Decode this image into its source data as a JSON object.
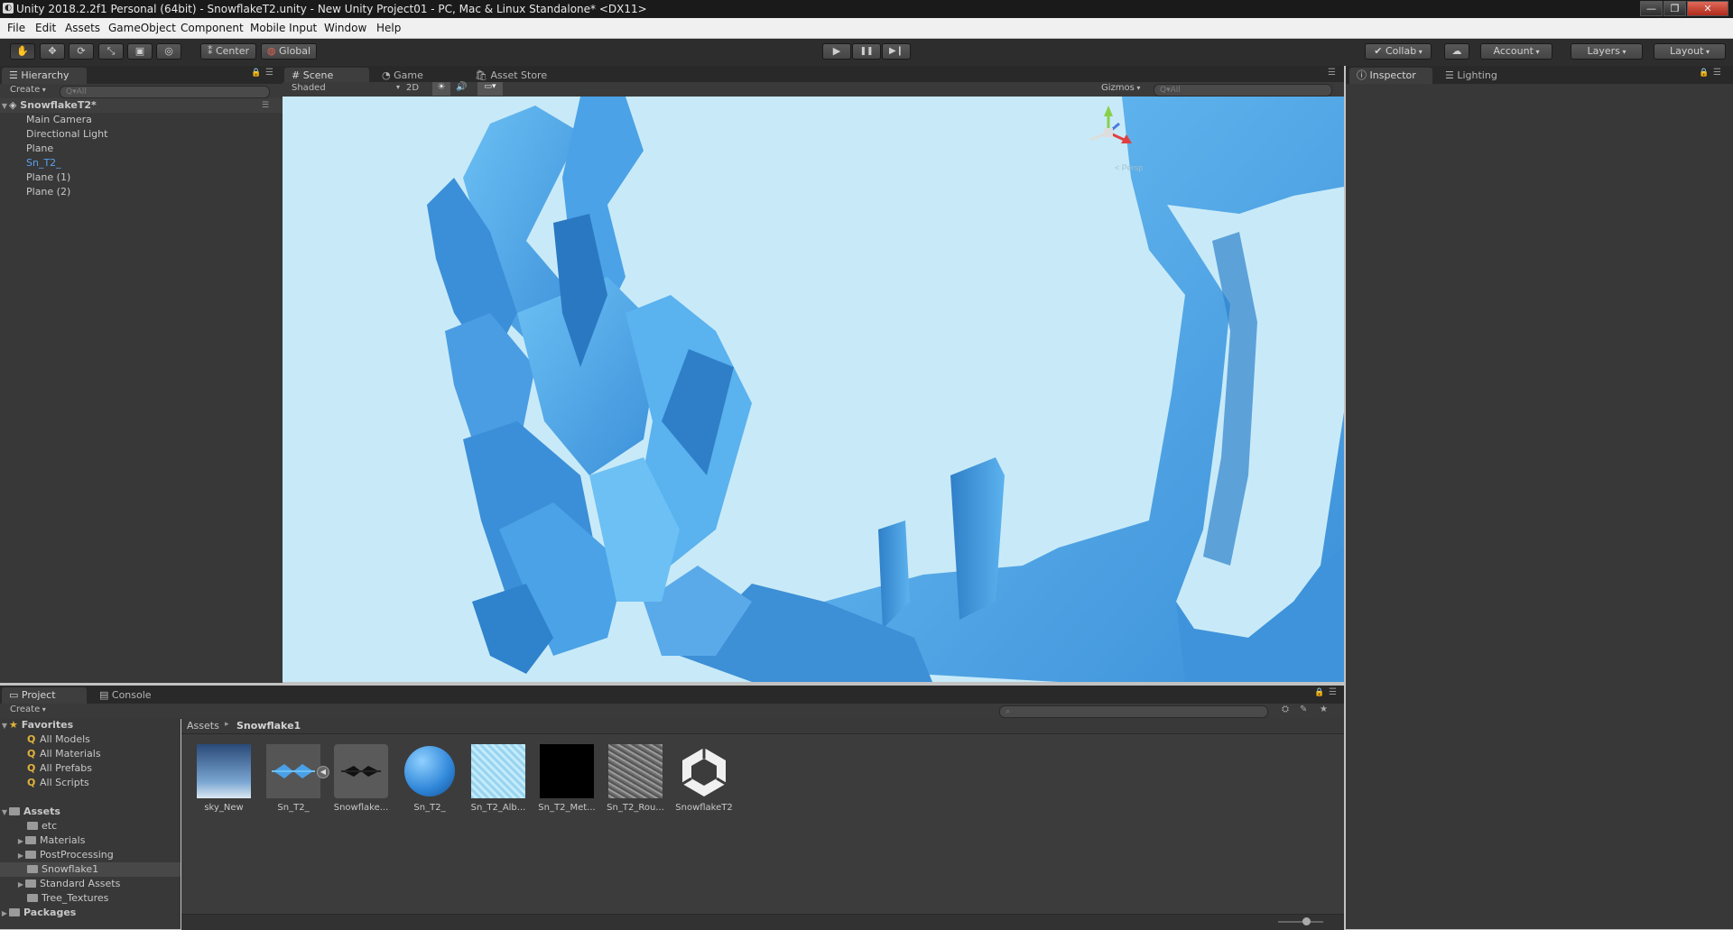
{
  "window": {
    "title": "Unity 2018.2.2f1 Personal (64bit) - SnowflakeT2.unity - New Unity Project01 - PC, Mac & Linux Standalone* <DX11>",
    "controls": [
      "—",
      "❐",
      "✕"
    ]
  },
  "menu": [
    "File",
    "Edit",
    "Assets",
    "GameObject",
    "Component",
    "Mobile Input",
    "Window",
    "Help"
  ],
  "toolbar": {
    "tools": [
      "hand-icon",
      "move-icon",
      "rotate-icon",
      "scale-icon",
      "rect-tool-icon",
      "transform-tool-icon"
    ],
    "pivot_label": "Center",
    "space_label": "Global",
    "play": "▶",
    "pause": "❚❚",
    "step": "▶❙",
    "collab_label": "Collab",
    "account_label": "Account",
    "layers_label": "Layers",
    "layout_label": "Layout"
  },
  "hierarchy": {
    "tab": "Hierarchy",
    "create": "Create",
    "search_placeholder": "Q▾All",
    "scene_name": "SnowflakeT2*",
    "items": [
      "Main Camera",
      "Directional Light",
      "Plane",
      "Sn_T2_",
      "Plane (1)",
      "Plane (2)"
    ],
    "highlight_color": "#5aa0ee"
  },
  "scene_view": {
    "tabs": [
      "Scene",
      "Game",
      "Asset Store"
    ],
    "shading": "Shaded",
    "mode_2d": "2D",
    "gizmos": "Gizmos",
    "search_placeholder": "Q▾All",
    "persp_label": "< Persp",
    "sky_color": "#c8eaf8",
    "ice_color": "#4aa3e6"
  },
  "inspector": {
    "tabs": [
      "Inspector",
      "Lighting"
    ]
  },
  "project": {
    "tabs": [
      "Project",
      "Console"
    ],
    "create": "Create",
    "favorites_label": "Favorites",
    "favorites": [
      "All Models",
      "All Materials",
      "All Prefabs",
      "All Scripts"
    ],
    "assets_label": "Assets",
    "folders": [
      "etc",
      "Materials",
      "PostProcessing",
      "Snowflake1",
      "Standard Assets",
      "Tree_Textures"
    ],
    "packages_label": "Packages",
    "breadcrumb_root": "Assets",
    "breadcrumb_current": "Snowflake1",
    "assets": [
      "sky_New",
      "Sn_T2_",
      "Snowflake...",
      "Sn_T2_",
      "Sn_T2_Alb...",
      "Sn_T2_Met...",
      "Sn_T2_Rou...",
      "SnowflakeT2"
    ]
  }
}
